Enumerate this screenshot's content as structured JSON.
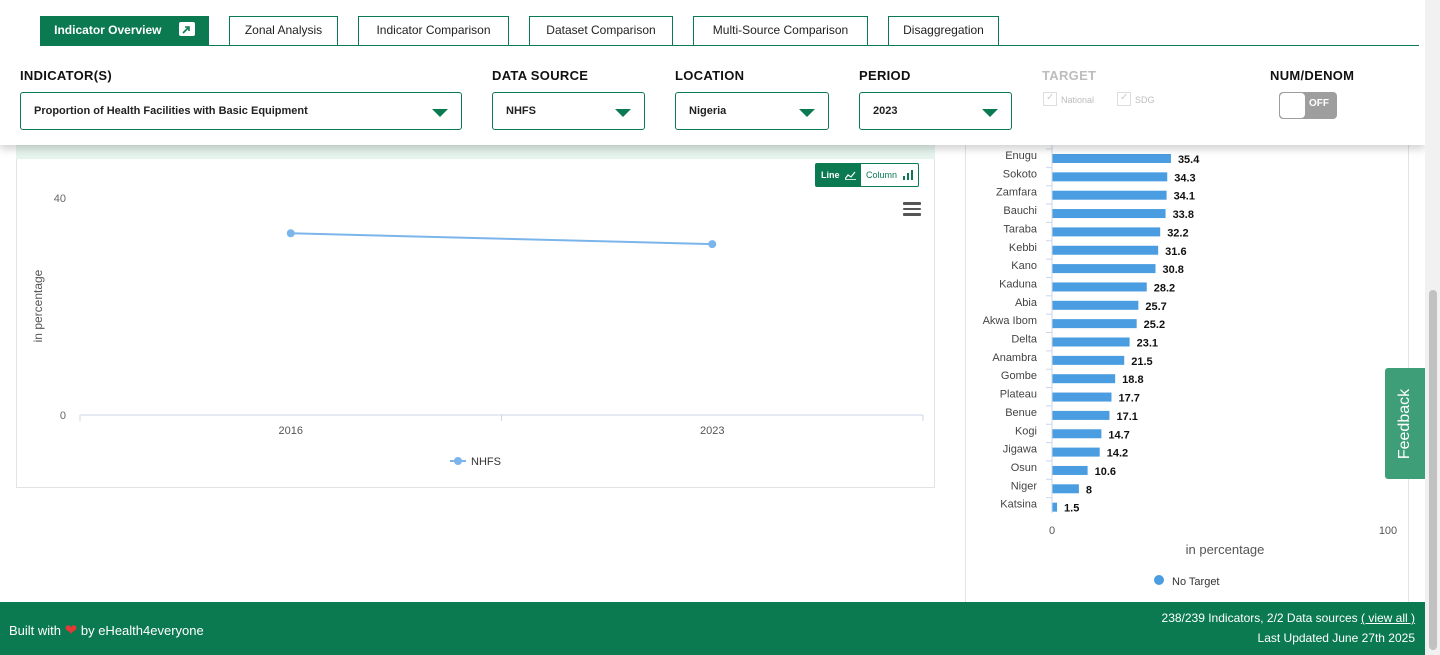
{
  "tabs": [
    {
      "label": "Indicator Overview",
      "active": true
    },
    {
      "label": "Zonal Analysis",
      "active": false
    },
    {
      "label": "Indicator Comparison",
      "active": false
    },
    {
      "label": "Dataset Comparison",
      "active": false
    },
    {
      "label": "Multi-Source Comparison",
      "active": false
    },
    {
      "label": "Disaggregation",
      "active": false
    }
  ],
  "filters": {
    "indicator": {
      "label": "INDICATOR(S)",
      "value": "Proportion of Health Facilities with Basic Equipment"
    },
    "data_source": {
      "label": "DATA SOURCE",
      "value": "NHFS"
    },
    "location": {
      "label": "LOCATION",
      "value": "Nigeria"
    },
    "period": {
      "label": "PERIOD",
      "value": "2023"
    },
    "target": {
      "label": "TARGET",
      "national": "National",
      "sdg": "SDG"
    },
    "num_denom": {
      "label": "NUM/DENOM",
      "toggle": "OFF"
    }
  },
  "view_toggle": {
    "line": "Line",
    "column": "Column"
  },
  "colors": {
    "brand": "#0b7a50",
    "line": "#7cb5ec",
    "bar": "#4a9de0"
  },
  "chart_data": [
    {
      "type": "line",
      "x": [
        "2016",
        "2023"
      ],
      "series": [
        {
          "name": "NHFS",
          "values": [
            33.5,
            31.5
          ]
        }
      ],
      "ylabel": "in percentage",
      "ylim": [
        0,
        40
      ],
      "yticks": [
        "0",
        "40"
      ],
      "legend": "bottom-center"
    },
    {
      "type": "bar",
      "orientation": "horizontal",
      "categories": [
        "Enugu",
        "Sokoto",
        "Zamfara",
        "Bauchi",
        "Taraba",
        "Kebbi",
        "Kano",
        "Kaduna",
        "Abia",
        "Akwa Ibom",
        "Delta",
        "Anambra",
        "Gombe",
        "Plateau",
        "Benue",
        "Kogi",
        "Jigawa",
        "Osun",
        "Niger",
        "Katsina"
      ],
      "values": [
        35.4,
        34.3,
        34.1,
        33.8,
        32.2,
        31.6,
        30.8,
        28.2,
        25.7,
        25.2,
        23.1,
        21.5,
        18.8,
        17.7,
        17.1,
        14.7,
        14.2,
        10.6,
        8,
        1.5
      ],
      "xlabel": "in percentage",
      "xlim": [
        0,
        100
      ],
      "xticks": [
        "0",
        "100"
      ],
      "series": [
        {
          "name": "No Target"
        }
      ],
      "legend": "bottom-center"
    }
  ],
  "feedback": "Feedback",
  "footer": {
    "built_prefix": "Built with",
    "built_suffix": "by eHealth4everyone",
    "stats": "238/239  Indicators, 2/2  Data sources",
    "view_all": "( view all )",
    "updated": "Last Updated June 27th 2025"
  }
}
